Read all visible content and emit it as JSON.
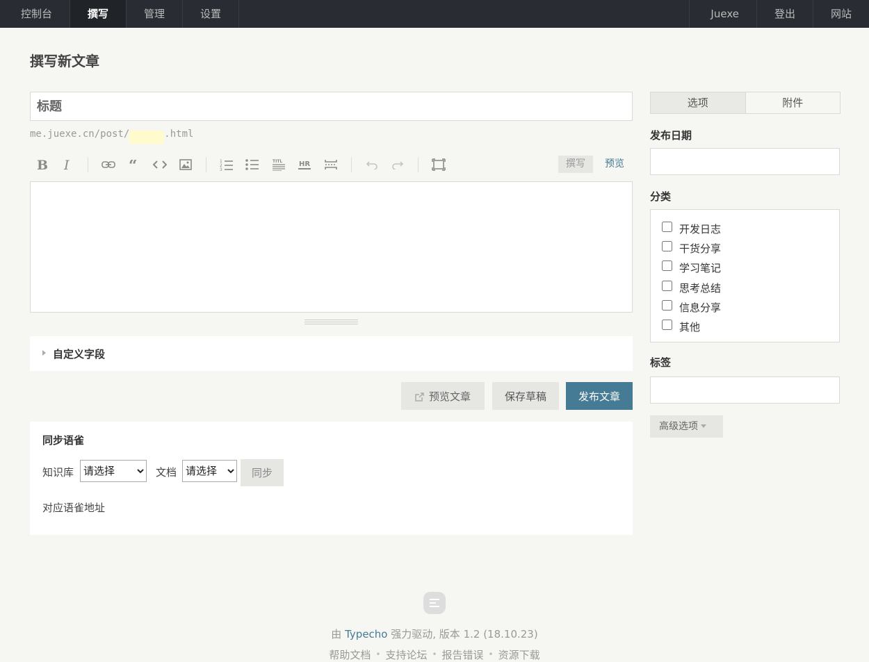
{
  "nav": {
    "left": [
      "控制台",
      "撰写",
      "管理",
      "设置"
    ],
    "right": [
      "Juexe",
      "登出",
      "网站"
    ]
  },
  "page_title": "撰写新文章",
  "title_input": {
    "placeholder": "标题",
    "value": ""
  },
  "url": {
    "prefix": "me.juexe.cn/post/",
    "slug": "",
    "suffix": ".html"
  },
  "toolbar": {
    "icons": [
      "bold-icon",
      "italic-icon",
      "link-icon",
      "quote-icon",
      "code-icon",
      "image-icon",
      "ordered-list-icon",
      "unordered-list-icon",
      "heading-icon",
      "hr-icon",
      "more-icon",
      "undo-icon",
      "redo-icon",
      "fullscreen-icon"
    ],
    "write_label": "撰写",
    "preview_label": "预览"
  },
  "custom_fields_label": "自定义字段",
  "buttons": {
    "preview": "预览文章",
    "save_draft": "保存草稿",
    "publish": "发布文章"
  },
  "sync": {
    "title": "同步语雀",
    "kb_label": "知识库",
    "kb_selected": "请选择",
    "doc_label": "文档",
    "doc_selected": "请选择",
    "sync_button": "同步",
    "address_label": "对应语雀地址"
  },
  "sidebar": {
    "tabs": [
      "选项",
      "附件"
    ],
    "date_label": "发布日期",
    "category_label": "分类",
    "categories": [
      "开发日志",
      "干货分享",
      "学习笔记",
      "思考总结",
      "信息分享",
      "其他"
    ],
    "tags_label": "标签",
    "advanced_label": "高级选项"
  },
  "footer": {
    "by": "由",
    "brand": "Typecho",
    "powered": "强力驱动, 版本 1.2 (18.10.23)",
    "links": [
      "帮助文档",
      "支持论坛",
      "报告错误",
      "资源下载"
    ]
  },
  "colors": {
    "nav_bg": "#292d33",
    "accent": "#467b96",
    "page_bg": "#f6f6f3"
  }
}
